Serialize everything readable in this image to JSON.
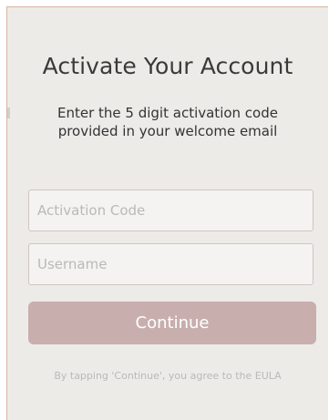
{
  "header": {
    "title": "Activate Your Account",
    "subtitle_line1": "Enter the 5 digit activation code",
    "subtitle_line2": "provided in your welcome email"
  },
  "form": {
    "activation_code": {
      "value": "",
      "placeholder": "Activation Code"
    },
    "username": {
      "value": "",
      "placeholder": "Username"
    },
    "continue_label": "Continue",
    "eula_text": "By tapping 'Continue', you agree to the EULA"
  },
  "colors": {
    "background": "#ecebe8",
    "button": "#c9aeae",
    "text": "#333333",
    "placeholder": "#b9b9b9"
  }
}
